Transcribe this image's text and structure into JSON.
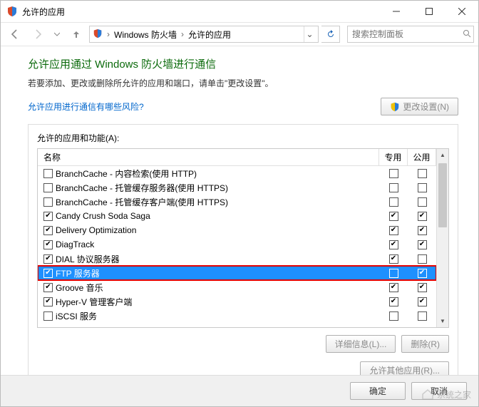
{
  "window": {
    "title": "允许的应用"
  },
  "nav": {
    "crumb1": "Windows 防火墙",
    "crumb2": "允许的应用",
    "search_placeholder": "搜索控制面板"
  },
  "page": {
    "title": "允许应用通过 Windows 防火墙进行通信",
    "subtitle": "若要添加、更改或删除所允许的应用和端口，请单击\"更改设置\"。",
    "risk_link": "允许应用进行通信有哪些风险?",
    "change_settings": "更改设置(N)"
  },
  "list": {
    "label": "允许的应用和功能(A):",
    "col_name": "名称",
    "col_private": "专用",
    "col_public": "公用",
    "rows": [
      {
        "name": "BranchCache - 内容检索(使用 HTTP)",
        "enabled": false,
        "private": false,
        "public": false
      },
      {
        "name": "BranchCache - 托管缓存服务器(使用 HTTPS)",
        "enabled": false,
        "private": false,
        "public": false
      },
      {
        "name": "BranchCache - 托管缓存客户端(使用 HTTPS)",
        "enabled": false,
        "private": false,
        "public": false
      },
      {
        "name": "Candy Crush Soda Saga",
        "enabled": true,
        "private": true,
        "public": true
      },
      {
        "name": "Delivery Optimization",
        "enabled": true,
        "private": true,
        "public": true
      },
      {
        "name": "DiagTrack",
        "enabled": true,
        "private": true,
        "public": true
      },
      {
        "name": "DIAL 协议服务器",
        "enabled": true,
        "private": true,
        "public": false
      },
      {
        "name": "FTP 服务器",
        "enabled": true,
        "private": false,
        "public": true,
        "selected": true,
        "highlight": true
      },
      {
        "name": "Groove 音乐",
        "enabled": true,
        "private": true,
        "public": true
      },
      {
        "name": "Hyper-V 管理客户端",
        "enabled": true,
        "private": true,
        "public": true
      },
      {
        "name": "iSCSI 服务",
        "enabled": false,
        "private": false,
        "public": false
      }
    ],
    "details": "详细信息(L)...",
    "remove": "删除(R)",
    "allow_other": "允许其他应用(R)..."
  },
  "footer": {
    "ok": "确定",
    "cancel": "取消"
  },
  "watermark": "系统之家"
}
